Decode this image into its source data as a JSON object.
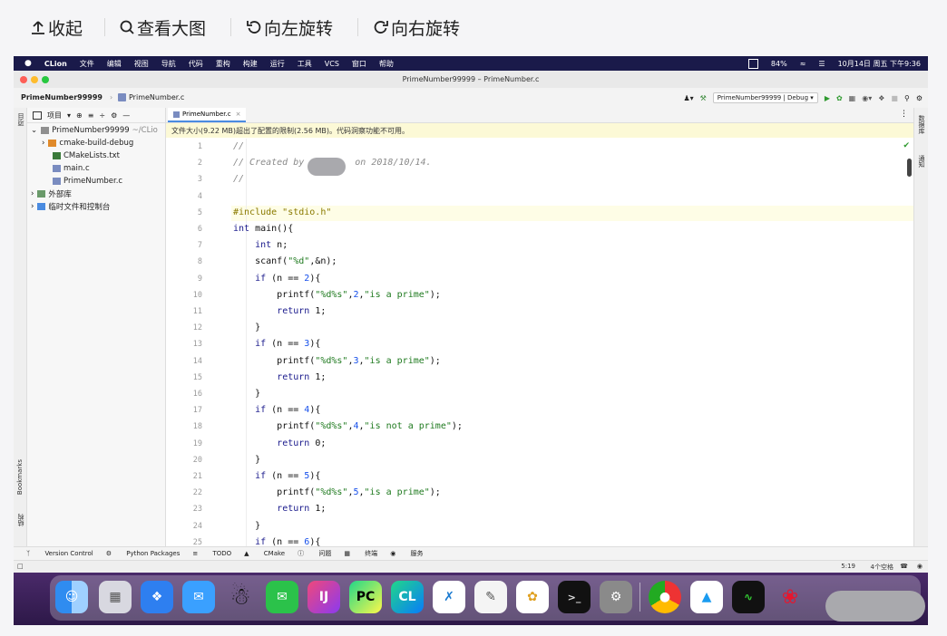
{
  "viewer_toolbar": {
    "collapse_label": "收起",
    "view_large_label": "查看大图",
    "rotate_left_label": "向左旋转",
    "rotate_right_label": "向右旋转"
  },
  "menubar": {
    "app": "CLion",
    "items": [
      "文件",
      "编辑",
      "视图",
      "导航",
      "代码",
      "重构",
      "构建",
      "运行",
      "工具",
      "VCS",
      "窗口",
      "帮助"
    ],
    "battery": "84%",
    "datetime": "10月14日 周五 下午9:36"
  },
  "window": {
    "title": "PrimeNumber99999 – PrimeNumber.c"
  },
  "navbar": {
    "project": "PrimeNumber99999",
    "file": "PrimeNumber.c",
    "run_config": "PrimeNumber99999 | Debug"
  },
  "project_panel": {
    "header_label": "项目",
    "root": "PrimeNumber99999",
    "root_path": "~/CLio",
    "items": [
      "cmake-build-debug",
      "CMakeLists.txt",
      "main.c",
      "PrimeNumber.c"
    ],
    "external": "外部库",
    "scratches": "临时文件和控制台"
  },
  "left_strip": {
    "project": "项目",
    "bookmarks": "Bookmarks",
    "structure": "结构"
  },
  "right_strip": {
    "db": "数据库",
    "notifications": "通知"
  },
  "editor": {
    "tab": "PrimeNumber.c",
    "warning": "文件大小(9.22 MB)超出了配置的限制(2.56 MB)。代码洞察功能不可用。",
    "line_numbers": [
      "1",
      "2",
      "3",
      "4",
      "5",
      "6",
      "7",
      "8",
      "9",
      "10",
      "11",
      "12",
      "13",
      "14",
      "15",
      "16",
      "17",
      "18",
      "19",
      "20",
      "21",
      "22",
      "23",
      "24",
      "25"
    ],
    "lines": [
      "//",
      "// Created by",
      "//",
      "",
      "#include \"stdio.h\"",
      "int main(){",
      "    int n;",
      "    scanf(\"%d\",&n);",
      "    if (n == 2){",
      "        printf(\"%d%s\",2,\"is a prime\");",
      "        return 1;",
      "    }",
      "    if (n == 3){",
      "        printf(\"%d%s\",3,\"is a prime\");",
      "        return 1;",
      "    }",
      "    if (n == 4){",
      "        printf(\"%d%s\",4,\"is not a prime\");",
      "        return 0;",
      "    }",
      "    if (n == 5){",
      "        printf(\"%d%s\",5,\"is a prime\");",
      "        return 1;",
      "    }",
      "    if (n == 6){"
    ],
    "created_on": "on 2018/10/14."
  },
  "bottom_tools": [
    "Version Control",
    "Python Packages",
    "TODO",
    "CMake",
    "问题",
    "终端",
    "服务"
  ],
  "status": {
    "position": "5:19",
    "indent": "4个空格"
  },
  "dock": [
    "Finder",
    "Launchpad",
    "Safari",
    "Mail",
    "QQ",
    "WeChat",
    "IntelliJ IDEA",
    "PyCharm",
    "CLion",
    "VS Code",
    "TextEdit",
    "Wine",
    "Terminal",
    "System Preferences",
    "Chrome",
    "Toolbox",
    "Activity Monitor",
    "Weibo"
  ],
  "colors": {
    "menubar": "#1a1a4a",
    "accent": "#4a8be0",
    "warning_bg": "#fcf9d6",
    "dock_bg": "#2d1848"
  }
}
